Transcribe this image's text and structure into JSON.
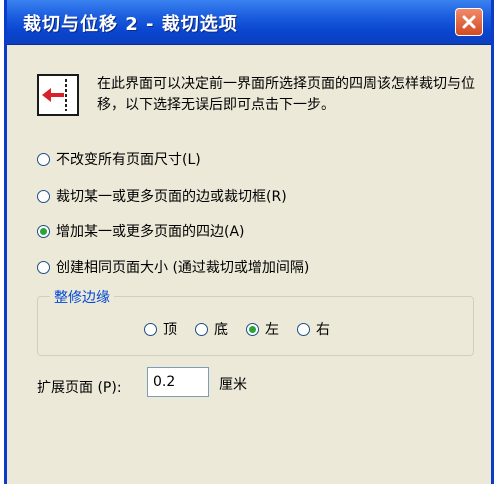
{
  "window": {
    "title": "裁切与位移 2 - 裁切选项"
  },
  "info": {
    "icon": "arrow-left-margin-icon",
    "text": "在此界面可以决定前一界面所选择页面的四周该怎样裁切与位移，以下选择无误后即可点击下一步。"
  },
  "options": [
    {
      "label": "不改变所有页面尺寸(L)",
      "checked": false
    },
    {
      "label": "裁切某一或更多页面的边或裁切框(R)",
      "checked": false
    },
    {
      "label": "增加某一或更多页面的四边(A)",
      "checked": true
    },
    {
      "label": "创建相同页面大小 (通过裁切或增加间隔)",
      "checked": false
    }
  ],
  "trim_group": {
    "legend": "整修边缘",
    "options": [
      {
        "label": "顶",
        "checked": false
      },
      {
        "label": "底",
        "checked": false
      },
      {
        "label": "左",
        "checked": true
      },
      {
        "label": "右",
        "checked": false
      }
    ]
  },
  "expand": {
    "label": "扩展页面 (P):",
    "value": "0.2",
    "unit": "厘米"
  },
  "colors": {
    "title_bar": "#0a46d0",
    "dialog_bg": "#ece9d8",
    "close_button": "#d24a22",
    "group_legend": "#0046d5"
  }
}
